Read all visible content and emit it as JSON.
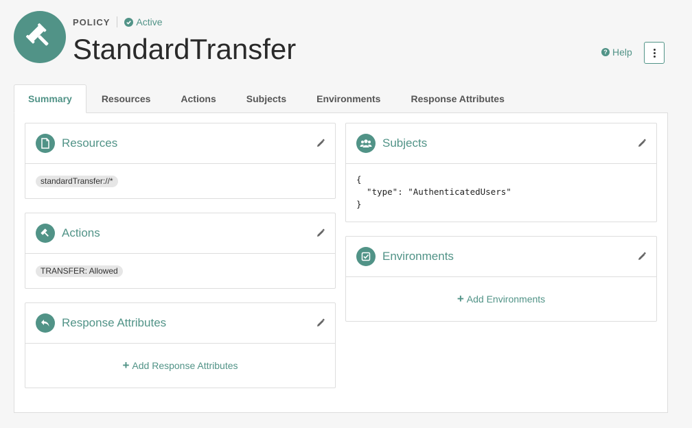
{
  "header": {
    "type_label": "POLICY",
    "status": "Active",
    "title": "StandardTransfer",
    "help_label": "Help"
  },
  "tabs": [
    {
      "label": "Summary"
    },
    {
      "label": "Resources"
    },
    {
      "label": "Actions"
    },
    {
      "label": "Subjects"
    },
    {
      "label": "Environments"
    },
    {
      "label": "Response Attributes"
    }
  ],
  "cards": {
    "resources": {
      "title": "Resources",
      "chip": "standardTransfer://*"
    },
    "actions": {
      "title": "Actions",
      "chip": "TRANSFER: Allowed"
    },
    "response_attributes": {
      "title": "Response Attributes",
      "add_label": "Add Response Attributes"
    },
    "subjects": {
      "title": "Subjects",
      "code": "{\n  \"type\": \"AuthenticatedUsers\"\n}"
    },
    "environments": {
      "title": "Environments",
      "add_label": "Add Environments"
    }
  },
  "colors": {
    "accent": "#519387",
    "background": "#f6f6f6"
  }
}
